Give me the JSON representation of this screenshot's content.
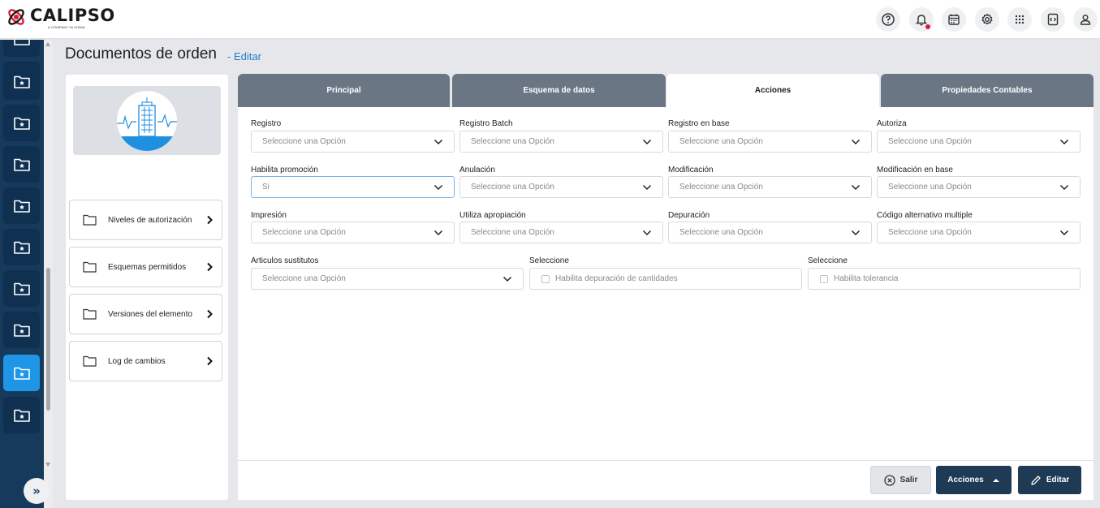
{
  "app": {
    "name": "CALIPSO",
    "tagline": "A COMPANY IN VISMA"
  },
  "topbar": {
    "icons": [
      "help-icon",
      "bell-icon",
      "calendar-icon",
      "gear-icon",
      "apps-grid-icon",
      "code-panel-icon",
      "user-icon"
    ]
  },
  "sidebar": {
    "items": [
      "calculator-icon",
      "folder-star-icon",
      "folder-star-icon",
      "folder-star-icon",
      "folder-star-icon",
      "folder-star-icon",
      "folder-star-icon",
      "folder-star-icon",
      "folder-star-icon",
      "folder-star-icon"
    ],
    "active_index": 8,
    "expand_label": "»"
  },
  "page": {
    "title": "Documentos de orden",
    "edit_link": "- Editar"
  },
  "left_nav": [
    {
      "label": "Niveles de autorización"
    },
    {
      "label": "Esquemas permitidos"
    },
    {
      "label": "Versiones del elemento"
    },
    {
      "label": "Log de cambios"
    }
  ],
  "tabs": [
    {
      "label": "Principal"
    },
    {
      "label": "Esquema de datos"
    },
    {
      "label": "Acciones",
      "active": true
    },
    {
      "label": "Propiedades Contables"
    }
  ],
  "form": {
    "placeholder": "Seleccione una Opción",
    "fields": [
      {
        "label": "Registro",
        "value": "Seleccione una Opción"
      },
      {
        "label": "Registro Batch",
        "value": "Seleccione una Opción"
      },
      {
        "label": "Registro en base",
        "value": "Seleccione una Opción"
      },
      {
        "label": "Autoriza",
        "value": "Seleccione una Opción"
      },
      {
        "label": "Habilita promoción",
        "value": "Si"
      },
      {
        "label": "Anulación",
        "value": "Seleccione una Opción"
      },
      {
        "label": "Modificación",
        "value": "Seleccione una Opción"
      },
      {
        "label": "Modificación en base",
        "value": "Seleccione una Opción"
      },
      {
        "label": "Impresión",
        "value": "Seleccione una Opción"
      },
      {
        "label": "Utiliza apropiación",
        "value": "Seleccione una Opción"
      },
      {
        "label": "Depuración",
        "value": "Seleccione una Opción"
      },
      {
        "label": "Código alternativo multiple",
        "value": "Seleccione una Opción"
      },
      {
        "label": "Articulos sustitutos",
        "value": "Seleccione una Opción"
      }
    ],
    "checkboxes": [
      {
        "group_label": "Seleccione",
        "label": "Habilita depuración de cantidades",
        "checked": false
      },
      {
        "group_label": "Seleccione",
        "label": "Habilita tolerancia",
        "checked": false
      }
    ]
  },
  "footer": {
    "salir": "Salir",
    "acciones": "Acciones",
    "editar": "Editar"
  },
  "colors": {
    "sidebar": "#163a5c",
    "active": "#1f95e6",
    "tab": "#6b7685",
    "primary_button": "#1f3a55",
    "link": "#1c7ed6"
  }
}
